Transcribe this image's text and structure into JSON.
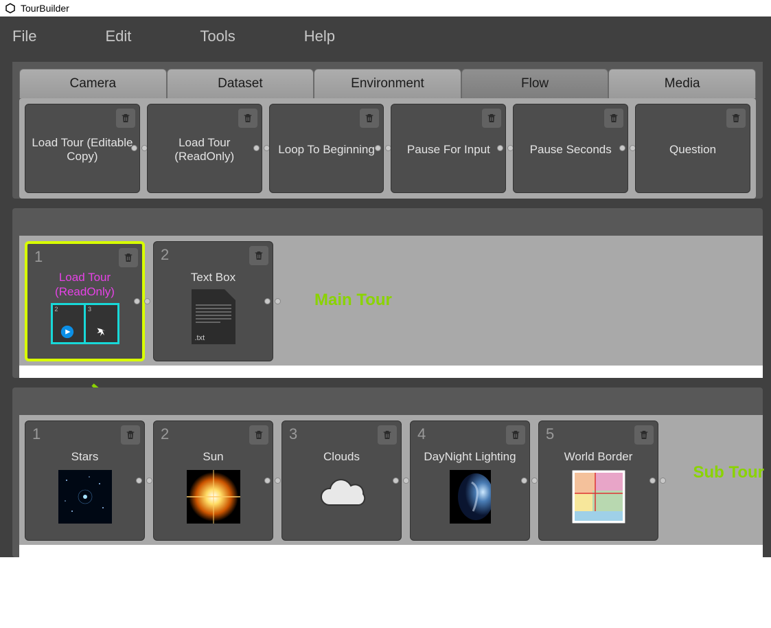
{
  "app": {
    "title": "TourBuilder"
  },
  "menubar": {
    "items": [
      "File",
      "Edit",
      "Tools",
      "Help"
    ]
  },
  "tabs": {
    "items": [
      "Camera",
      "Dataset",
      "Environment",
      "Flow",
      "Media"
    ],
    "active": "Flow"
  },
  "palette": {
    "tiles": [
      {
        "label": "Load Tour (Editable Copy)"
      },
      {
        "label": "Load Tour (ReadOnly)"
      },
      {
        "label": "Loop To Beginning"
      },
      {
        "label": "Pause For Input"
      },
      {
        "label": "Pause Seconds"
      },
      {
        "label": "Question"
      }
    ]
  },
  "mainTour": {
    "annotation": "Main Tour",
    "slots": [
      {
        "num": "1",
        "label": "Load Tour (ReadOnly)",
        "selected": true
      },
      {
        "num": "2",
        "label": "Text Box",
        "ext": ".txt"
      }
    ]
  },
  "subTour": {
    "annotation": "Sub Tour",
    "slots": [
      {
        "num": "1",
        "label": "Stars"
      },
      {
        "num": "2",
        "label": "Sun"
      },
      {
        "num": "3",
        "label": "Clouds"
      },
      {
        "num": "4",
        "label": "DayNight Lighting"
      },
      {
        "num": "5",
        "label": "World Border"
      }
    ]
  }
}
